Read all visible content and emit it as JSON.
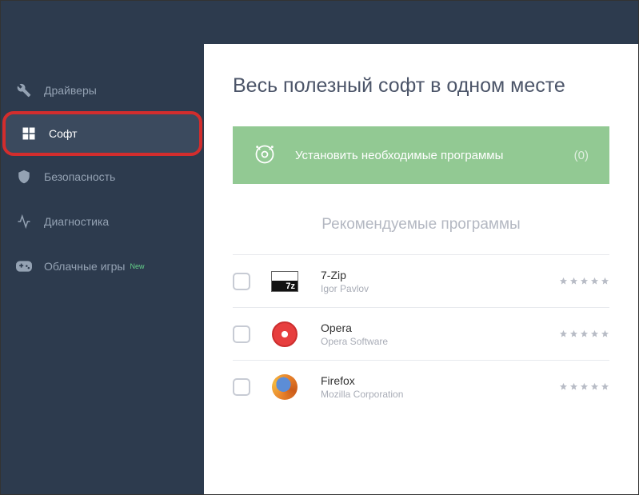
{
  "sidebar": {
    "items": [
      {
        "label": "Драйверы",
        "icon": "wrench-icon"
      },
      {
        "label": "Софт",
        "icon": "grid-icon",
        "active": true
      },
      {
        "label": "Безопасность",
        "icon": "shield-icon"
      },
      {
        "label": "Диагностика",
        "icon": "pulse-icon"
      },
      {
        "label": "Облачные игры",
        "icon": "gamepad-icon",
        "badge": "New"
      }
    ]
  },
  "main": {
    "title": "Весь полезный софт в одном месте",
    "install_button": {
      "label": "Установить необходимые программы",
      "count": "(0)"
    },
    "section_title": "Рекомендуемые программы",
    "apps": [
      {
        "name": "7-Zip",
        "vendor": "Igor Pavlov",
        "stars": 5,
        "icon": "sevenzip-icon"
      },
      {
        "name": "Opera",
        "vendor": "Opera Software",
        "stars": 5,
        "icon": "opera-icon"
      },
      {
        "name": "Firefox",
        "vendor": "Mozilla Corporation",
        "stars": 5,
        "icon": "firefox-icon"
      }
    ]
  }
}
